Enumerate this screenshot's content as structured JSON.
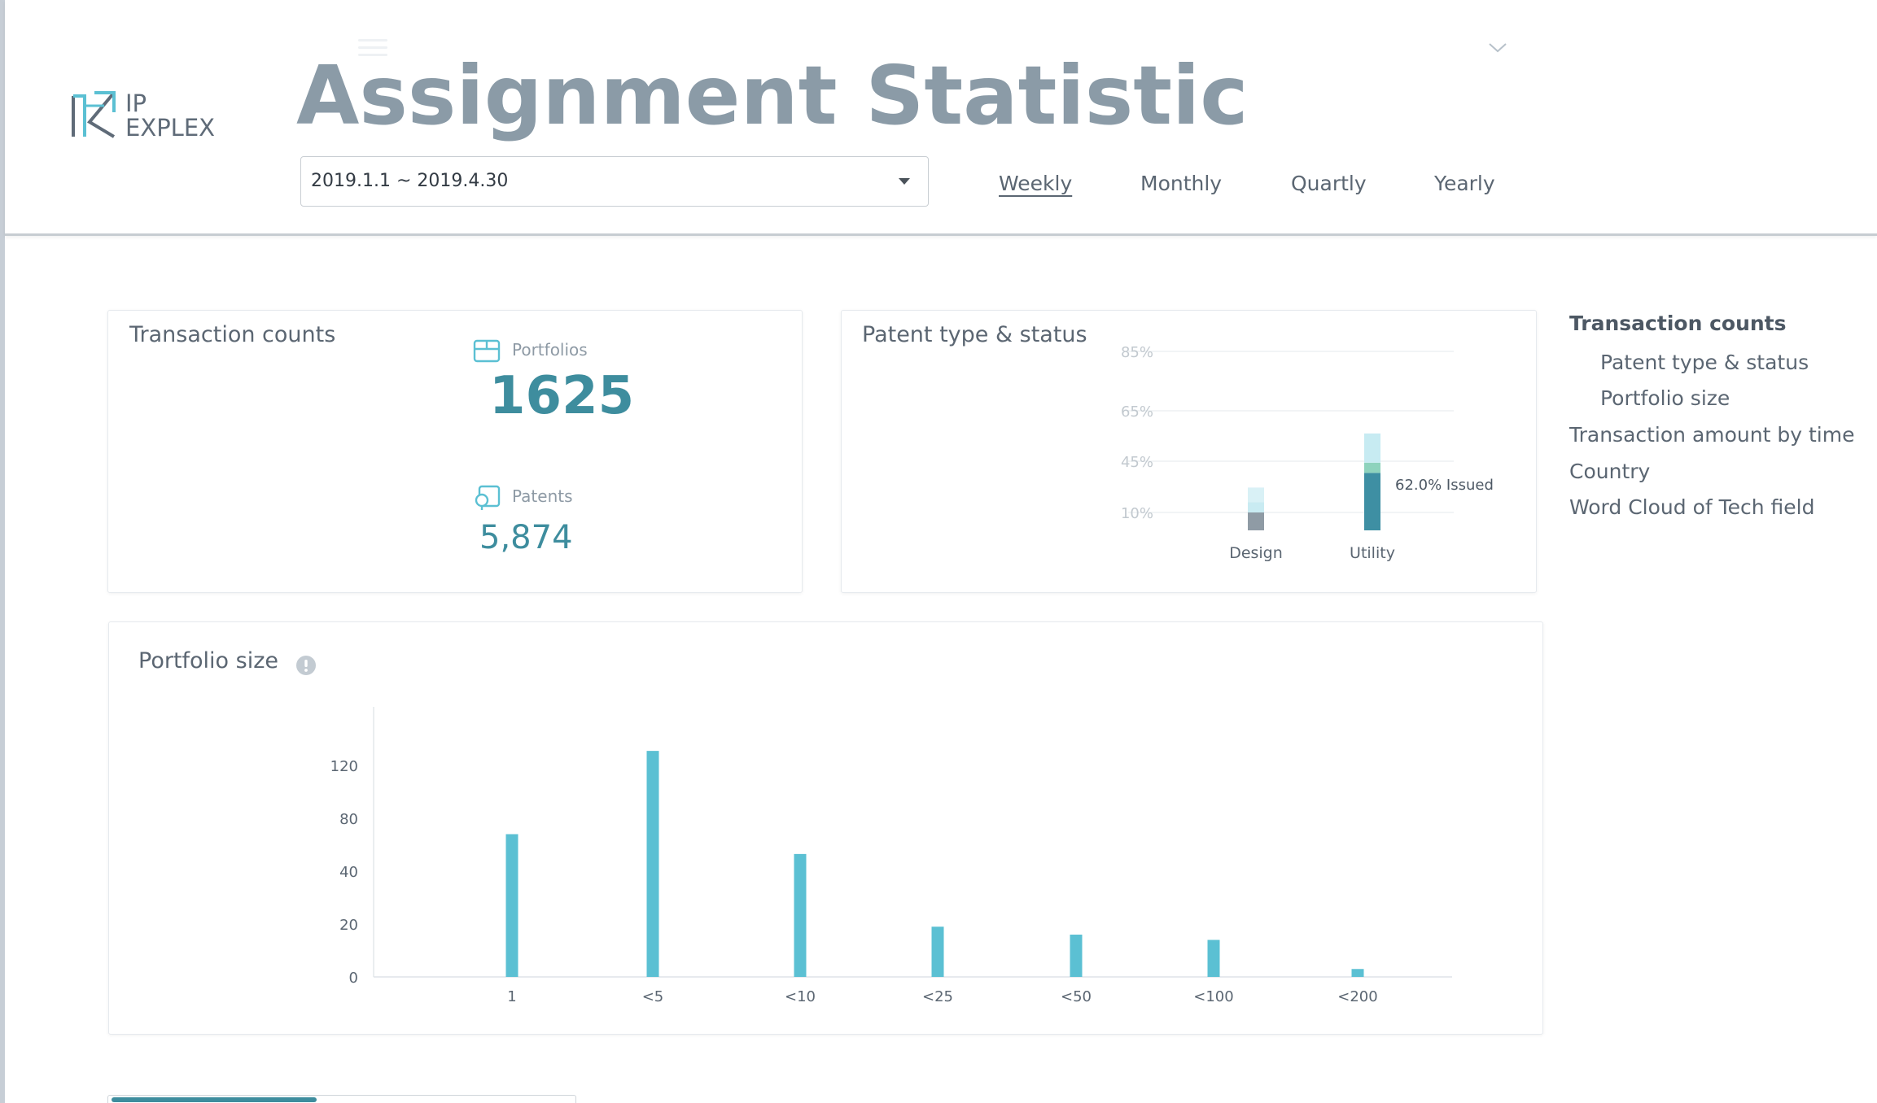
{
  "header": {
    "logo_line1": "IP",
    "logo_line2": "EXPLEX",
    "title": "Assignment Statistic",
    "date_range": "2019.1.1 ~ 2019.4.30",
    "periods": [
      "Weekly",
      "Monthly",
      "Quartly",
      "Yearly"
    ],
    "active_period": "Weekly"
  },
  "transaction_counts": {
    "title": "Transaction counts",
    "portfolios_label": "Portfolios",
    "portfolios_value": "1625",
    "patents_label": "Patents",
    "patents_value": "5,874"
  },
  "patent_type": {
    "title": "Patent type & status",
    "annotation": "62.0% Issued"
  },
  "portfolio_size": {
    "title": "Portfolio size"
  },
  "side_nav": {
    "items": [
      "Transaction counts",
      "Patent type & status",
      "Portfolio size",
      "Transaction amount by time",
      "Country",
      "Word Cloud of Tech field"
    ]
  },
  "colors": {
    "accent": "#3e8d9e",
    "bar": "#5bc0d3",
    "title_gray": "#8b9ba7",
    "utility_dark": "#3e8fa3",
    "utility_mid": "#8ed3bd",
    "utility_light": "#c7ebf2",
    "design_dark": "#8f9ba5",
    "design_light": "#c9ebf2"
  },
  "icons": [
    "logo-icon",
    "menu-icon",
    "chevron-down-icon",
    "caret-down-icon",
    "box-icon",
    "patent-icon",
    "info-icon"
  ],
  "chart_data": [
    {
      "type": "bar",
      "title": "Patent type & status",
      "categories": [
        "Design",
        "Utility"
      ],
      "y_tick_labels": [
        "10%",
        "45%",
        "65%",
        "85%"
      ],
      "stacked": true,
      "series": [
        {
          "values": [
            10,
            37
          ]
        },
        {
          "values": [
            7,
            7
          ]
        },
        {
          "values": [
            10,
            12
          ]
        }
      ],
      "annotations": [
        "62.0% Issued"
      ],
      "grid": true
    },
    {
      "type": "bar",
      "title": "Portfolio size",
      "categories": [
        "1",
        "<5",
        "<10",
        "<25",
        "<50",
        "<100",
        "<200"
      ],
      "values": [
        68,
        131,
        53,
        19,
        16,
        14,
        3
      ],
      "y_ticks": [
        0,
        20,
        40,
        80,
        120
      ],
      "grid": false
    }
  ]
}
